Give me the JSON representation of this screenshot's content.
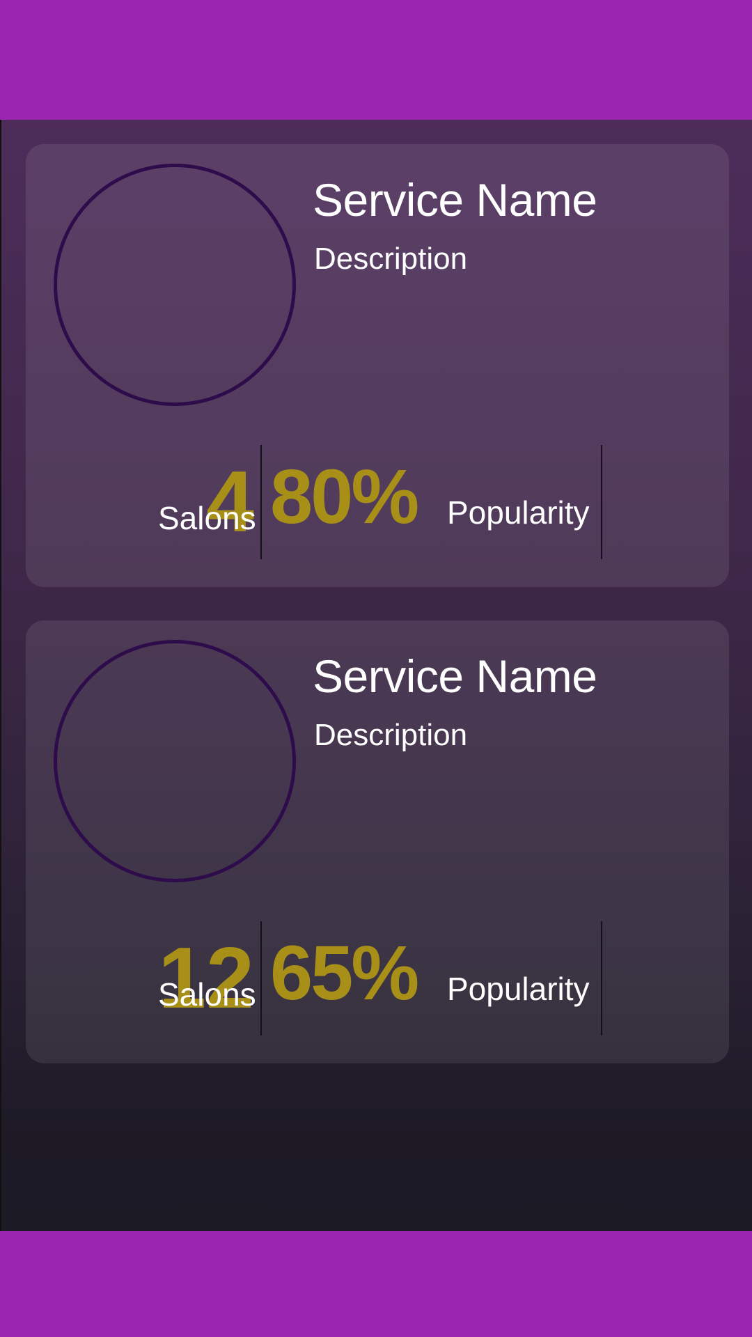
{
  "colors": {
    "bars": "#9b25b1",
    "accent_number": "#a89018",
    "avatar_ring": "#2e0b4a",
    "text": "#ffffff"
  },
  "cards": [
    {
      "name": "Service Name",
      "description": "Description",
      "salons_count": "4",
      "salons_label": "Salons",
      "popularity_value": "80%",
      "popularity_label": "Popularity"
    },
    {
      "name": "Service Name",
      "description": "Description",
      "salons_count": "12",
      "salons_label": "Salons",
      "popularity_value": "65%",
      "popularity_label": "Popularity"
    }
  ]
}
